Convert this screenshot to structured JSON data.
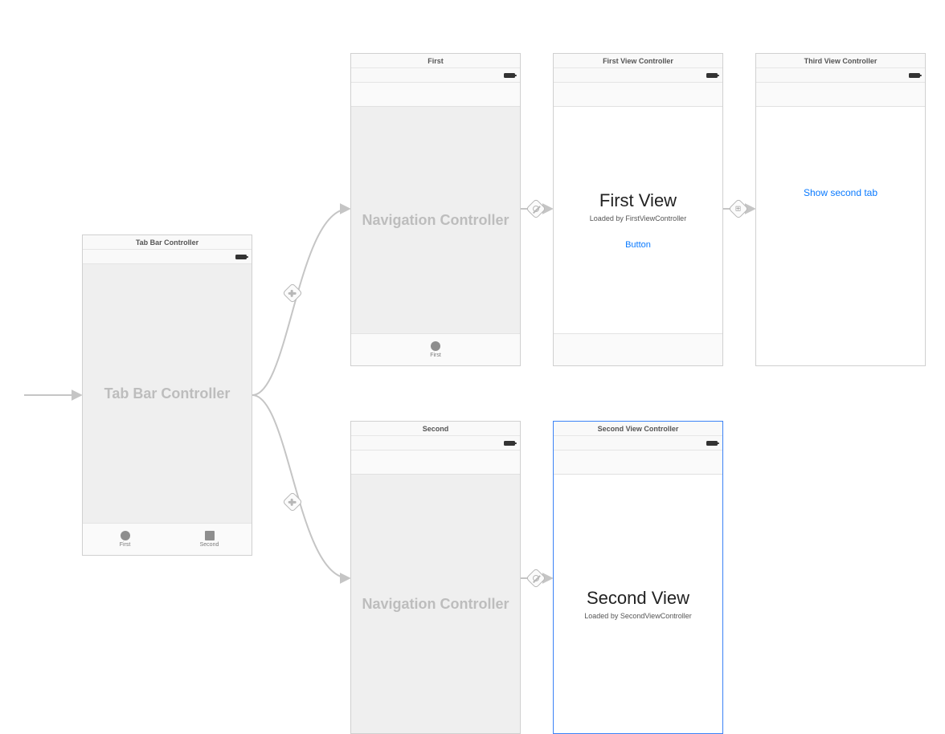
{
  "scenes": {
    "tabbar": {
      "title": "Tab Bar Controller",
      "placeholder": "Tab Bar Controller",
      "tabs": [
        {
          "label": "First"
        },
        {
          "label": "Second"
        }
      ]
    },
    "nav1": {
      "title": "First",
      "placeholder": "Navigation Controller",
      "tabs": [
        {
          "label": "First"
        }
      ]
    },
    "firstvc": {
      "title": "First View Controller",
      "heading": "First View",
      "subtitle": "Loaded by FirstViewController",
      "button": "Button"
    },
    "thirdvc": {
      "title": "Third View Controller",
      "link": "Show second tab"
    },
    "nav2": {
      "title": "Second",
      "placeholder": "Navigation Controller"
    },
    "secondvc": {
      "title": "Second View Controller",
      "heading": "Second View",
      "subtitle": "Loaded by SecondViewController"
    }
  },
  "segues": {
    "entry": "initial-view-controller-arrow",
    "tab_to_nav1": "relationship-viewControllers",
    "tab_to_nav2": "relationship-viewControllers",
    "nav1_root": "relationship-rootViewController",
    "nav2_root": "relationship-rootViewController",
    "first_to_third": "show-segue"
  }
}
